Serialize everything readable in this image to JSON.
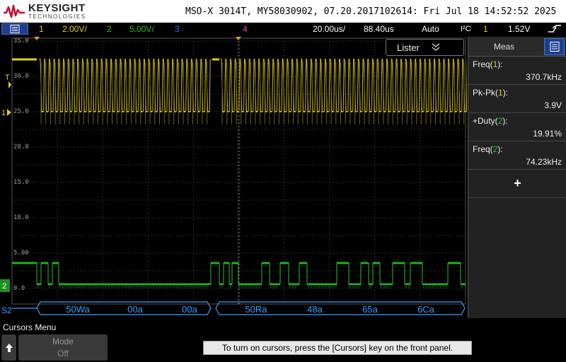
{
  "header": {
    "brand": "KEYSIGHT",
    "brand_sub": "TECHNOLOGIES",
    "title": "MSO-X 3014T, MY58030902, 07.20.2017102614: Fri Jul 18 14:52:52 2025"
  },
  "status": {
    "ch1_num": "1",
    "ch1_scale": "2.00V/",
    "ch2_num": "2",
    "ch2_scale": "5.00V/",
    "ch3_num": "3",
    "ch4_num": "4",
    "timebase": "20.00us/",
    "delay": "88.40us",
    "trigger_mode": "Auto",
    "trigger_type": "I²C",
    "trigger_source": "1",
    "trigger_level": "1.52V"
  },
  "grid": {
    "y_ticks": [
      "35.0",
      "30.0",
      "25.0",
      "20.0",
      "15.0",
      "10.0",
      "5.00",
      "0.0"
    ],
    "marker_t": "T",
    "marker_1": "1",
    "marker_2": "2",
    "marker_s2": "S2"
  },
  "decode": {
    "packets": [
      "50Wa",
      "00a",
      "00a",
      "50Ra",
      "48a",
      "65a",
      "6Ca"
    ]
  },
  "lister": {
    "label": "Lister"
  },
  "meas": {
    "title": "Meas",
    "rows": [
      {
        "label_prefix": "Freq(",
        "source": "1",
        "label_suffix": "):",
        "value": "370.7kHz"
      },
      {
        "label_prefix": "Pk-Pk(",
        "source": "1",
        "label_suffix": "):",
        "value": "3.9V"
      },
      {
        "label_prefix": "+Duty(",
        "source": "2",
        "label_suffix": "):",
        "value": "19.91%"
      },
      {
        "label_prefix": "Freq(",
        "source": "2",
        "label_suffix": "):",
        "value": "74.23kHz"
      }
    ],
    "add_label": "+"
  },
  "softkeys": {
    "menu_title": "Cursors Menu",
    "mode_label": "Mode",
    "mode_value": "Off",
    "hint": "To turn on cursors, press the [Cursors] key on the front panel."
  },
  "colors": {
    "ch1": "#e0d020",
    "ch2": "#22c322",
    "ch3": "#4a6dff",
    "ch4": "#e040c8",
    "decode": "#39a0ff"
  }
}
